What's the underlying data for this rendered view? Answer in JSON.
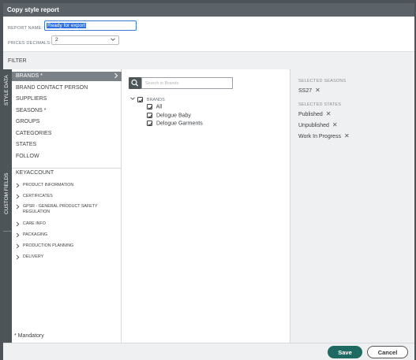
{
  "dialog": {
    "title": "Copy style report"
  },
  "form": {
    "report_name_label": "REPORT NAME:",
    "report_name_value": "Ready for export",
    "prices_decimals_label": "PRICES DECIMALS:",
    "prices_decimals_value": "2"
  },
  "filter": {
    "title": "FILTER"
  },
  "side_tabs": {
    "style_data": "STYLE DATA",
    "custom_fields": "CUSTOM FIELDS"
  },
  "style_data_items": [
    {
      "label": "BRANDS *"
    },
    {
      "label": "BRAND CONTACT PERSON"
    },
    {
      "label": "SUPPLIERS"
    },
    {
      "label": "SEASONS *"
    },
    {
      "label": "GROUPS"
    },
    {
      "label": "CATEGORIES"
    },
    {
      "label": "STATES"
    },
    {
      "label": "FOLLOW"
    }
  ],
  "custom_fields_items": {
    "keyaccount": "KEYACCOUNT",
    "children": [
      {
        "label": "PRODUCT INFORMATION"
      },
      {
        "label": "CERTIFICATES"
      },
      {
        "label": "GPSR - GENERAL PRODUCT SAFETY REGULATION"
      },
      {
        "label": "CARE INFO"
      },
      {
        "label": "PACKAGING"
      },
      {
        "label": "PRODUCTION PLANNING"
      },
      {
        "label": "DELIVERY"
      }
    ]
  },
  "mandatory_note": "* Mandatory",
  "brands_panel": {
    "search_placeholder": "Search in Brands",
    "group_label": "BRANDS",
    "options": [
      {
        "label": "All",
        "checked": true
      },
      {
        "label": "Delogue Baby",
        "checked": true
      },
      {
        "label": "Delogue Garments",
        "checked": true
      }
    ]
  },
  "selected": {
    "seasons_title": "SELECTED SEASONS",
    "seasons": [
      "SS27"
    ],
    "states_title": "SELECTED STATES",
    "states": [
      "Published",
      "Unpublished",
      "Work In Progress"
    ],
    "remove_glyph": "✕"
  },
  "footer": {
    "save_label": "Save",
    "cancel_label": "Cancel"
  },
  "colors": {
    "primary": "#1e6a63",
    "sidebar": "#4d5559",
    "active_item": "#7b8287",
    "titlebar": "#5b6268"
  }
}
